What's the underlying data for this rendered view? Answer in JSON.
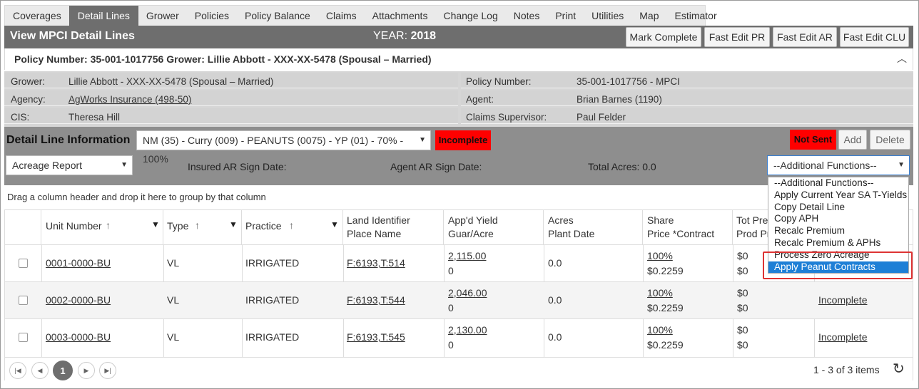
{
  "tabs": [
    "Coverages",
    "Detail Lines",
    "Grower",
    "Policies",
    "Policy Balance",
    "Claims",
    "Attachments",
    "Change Log",
    "Notes",
    "Print",
    "Utilities",
    "Map",
    "Estimator"
  ],
  "active_tab": "Detail Lines",
  "titlebar": {
    "title": "View MPCI Detail Lines",
    "year_label": "YEAR:",
    "year_value": "2018",
    "buttons": [
      "Mark Complete",
      "Fast Edit PR",
      "Fast Edit AR",
      "Fast Edit CLU"
    ]
  },
  "policy_header": "Policy Number: 35-001-1017756 Grower: Lillie Abbott - XXX-XX-5478 (Spousal – Married)",
  "info": {
    "grower_label": "Grower:",
    "grower_value": "Lillie Abbott - XXX-XX-5478 (Spousal – Married)",
    "agency_label": "Agency:",
    "agency_value": "AgWorks Insurance (498-50)",
    "cis_label": "CIS:",
    "cis_value": "Theresa Hill",
    "policy_label": "Policy Number:",
    "policy_value": "35-001-1017756 - MPCI",
    "agent_label": "Agent:",
    "agent_value": "Brian Barnes (1190)",
    "claims_label": "Claims Supervisor:",
    "claims_value": "Paul Felder"
  },
  "detail": {
    "title": "Detail Line Information",
    "line_select": "NM (35) - Curry (009) - PEANUTS (0075) - YP (01) - 70% - 100%",
    "status_badge": "Incomplete",
    "sent_badge": "Not Sent",
    "add_label": "Add",
    "delete_label": "Delete",
    "report_select": "Acreage Report",
    "insured_sign": "Insured AR Sign Date:",
    "agent_sign": "Agent AR Sign Date:",
    "total_acres": "Total Acres: 0.0",
    "functions_select": "--Additional Functions--"
  },
  "dropdown": {
    "items": [
      "--Additional Functions--",
      "Apply Current Year SA T-Yields",
      "Copy Detail Line",
      "Copy APH",
      "Recalc Premium",
      "Recalc Premium & APHs",
      "Process Zero Acreage",
      "Apply Peanut Contracts"
    ],
    "highlighted": "Apply Peanut Contracts"
  },
  "grid": {
    "group_hint": "Drag a column header and drop it here to group by that column",
    "headers": {
      "unit": "Unit Number",
      "type": "Type",
      "practice": "Practice",
      "land1": "Land Identifier",
      "land2": "Place Name",
      "yield1": "App'd Yield",
      "yield2": "Guar/Acre",
      "acres1": "Acres",
      "acres2": "Plant Date",
      "share1": "Share",
      "share2": "Price *Contract",
      "prem1": "Tot Prem",
      "prem2": "Prod Pr"
    },
    "sort_icon": "↑",
    "rows": [
      {
        "unit": "0001-0000-BU",
        "type": "VL",
        "practice": "IRRIGATED",
        "land": "F:6193,T:514",
        "yield": "2,115.00",
        "guar": "0",
        "acres": "0.0",
        "share": "100%",
        "price": "$0.2259",
        "prem1": "$0",
        "prem2": "$0",
        "status": ""
      },
      {
        "unit": "0002-0000-BU",
        "type": "VL",
        "practice": "IRRIGATED",
        "land": "F:6193,T:544",
        "yield": "2,046.00",
        "guar": "0",
        "acres": "0.0",
        "share": "100%",
        "price": "$0.2259",
        "prem1": "$0",
        "prem2": "$0",
        "status": "Incomplete"
      },
      {
        "unit": "0003-0000-BU",
        "type": "VL",
        "practice": "IRRIGATED",
        "land": "F:6193,T:545",
        "yield": "2,130.00",
        "guar": "0",
        "acres": "0.0",
        "share": "100%",
        "price": "$0.2259",
        "prem1": "$0",
        "prem2": "$0",
        "status": "Incomplete"
      }
    ],
    "pager": {
      "current": "1",
      "summary": "1 - 3 of 3 items"
    }
  }
}
